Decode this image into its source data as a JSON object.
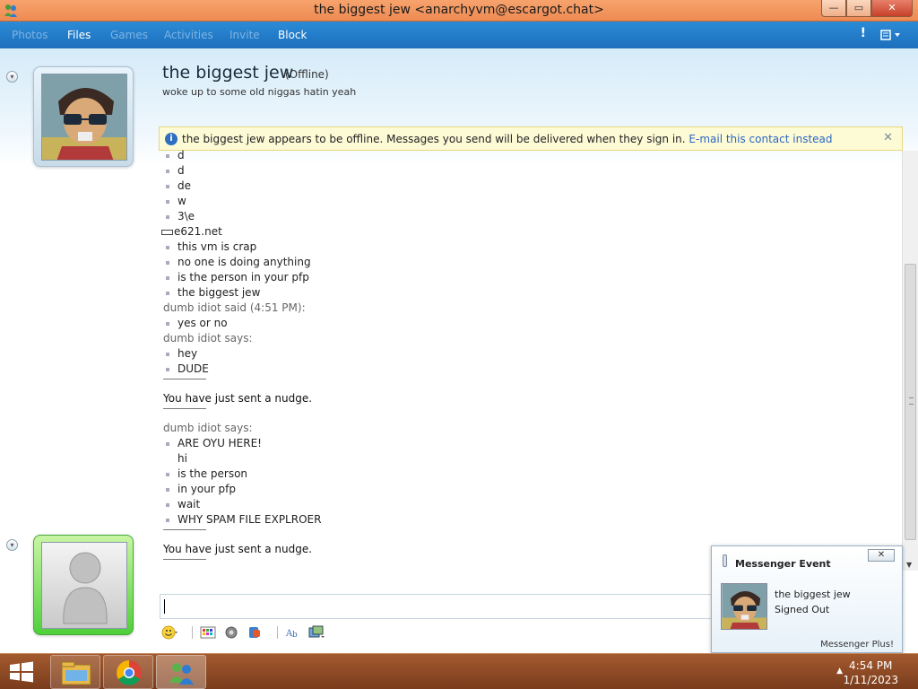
{
  "window": {
    "title": "the biggest jew <anarchyvm@escargot.chat>",
    "controls": {
      "minimize": "—",
      "maximize": "▭",
      "close": "✕"
    }
  },
  "toolbar": {
    "items": [
      {
        "label": "Photos",
        "enabled": false
      },
      {
        "label": "Files",
        "enabled": true
      },
      {
        "label": "Games",
        "enabled": false
      },
      {
        "label": "Activities",
        "enabled": false
      },
      {
        "label": "Invite",
        "enabled": false
      },
      {
        "label": "Block",
        "enabled": true
      }
    ],
    "alert_label": "!"
  },
  "contact": {
    "name": "the biggest jew",
    "status": "(Offline)",
    "personal_message": "woke up to some old niggas hatin yeah"
  },
  "infobar": {
    "message": "the biggest jew appears to be offline. Messages you send will be delivered when they sign in.",
    "link": "E-mail this contact instead",
    "close": "✕"
  },
  "conversation": {
    "lines": [
      {
        "type": "msg",
        "text": "d"
      },
      {
        "type": "msg",
        "text": "d"
      },
      {
        "type": "msg",
        "text": "de"
      },
      {
        "type": "msg",
        "text": "w"
      },
      {
        "type": "msg",
        "text": "3\\e"
      },
      {
        "type": "url",
        "text": "e621.net"
      },
      {
        "type": "msg",
        "text": "this vm is crap"
      },
      {
        "type": "msg",
        "text": "no one is doing anything"
      },
      {
        "type": "msg",
        "text": "is the person in your pfp"
      },
      {
        "type": "msg",
        "text": "the biggest jew"
      },
      {
        "type": "said",
        "text": "dumb idiot said (4:51 PM):"
      },
      {
        "type": "msg",
        "text": "yes or no"
      },
      {
        "type": "said",
        "text": "dumb idiot says:"
      },
      {
        "type": "msg",
        "text": "hey"
      },
      {
        "type": "msg",
        "text": "DUDE"
      },
      {
        "type": "sep"
      },
      {
        "type": "nudge",
        "text": "You have just sent a nudge."
      },
      {
        "type": "sep"
      },
      {
        "type": "said",
        "text": "dumb idiot says:"
      },
      {
        "type": "msg",
        "text": "ARE OYU HERE!"
      },
      {
        "type": "nobullet",
        "text": "hi"
      },
      {
        "type": "msg",
        "text": "is the person"
      },
      {
        "type": "msg",
        "text": "in your pfp"
      },
      {
        "type": "msg",
        "text": "wait"
      },
      {
        "type": "msg",
        "text": "WHY SPAM FILE EXPLROER"
      },
      {
        "type": "sep"
      },
      {
        "type": "nudge",
        "text": "You have just sent a nudge."
      },
      {
        "type": "sep"
      }
    ]
  },
  "input": {
    "value": ""
  },
  "toast": {
    "title": "Messenger Event",
    "contact": "the biggest jew",
    "event": "Signed Out",
    "footer": "Messenger Plus!",
    "close": "✕"
  },
  "taskbar": {
    "time": "4:54 PM",
    "date": "1/11/2023",
    "tray_arrow": "▲"
  }
}
